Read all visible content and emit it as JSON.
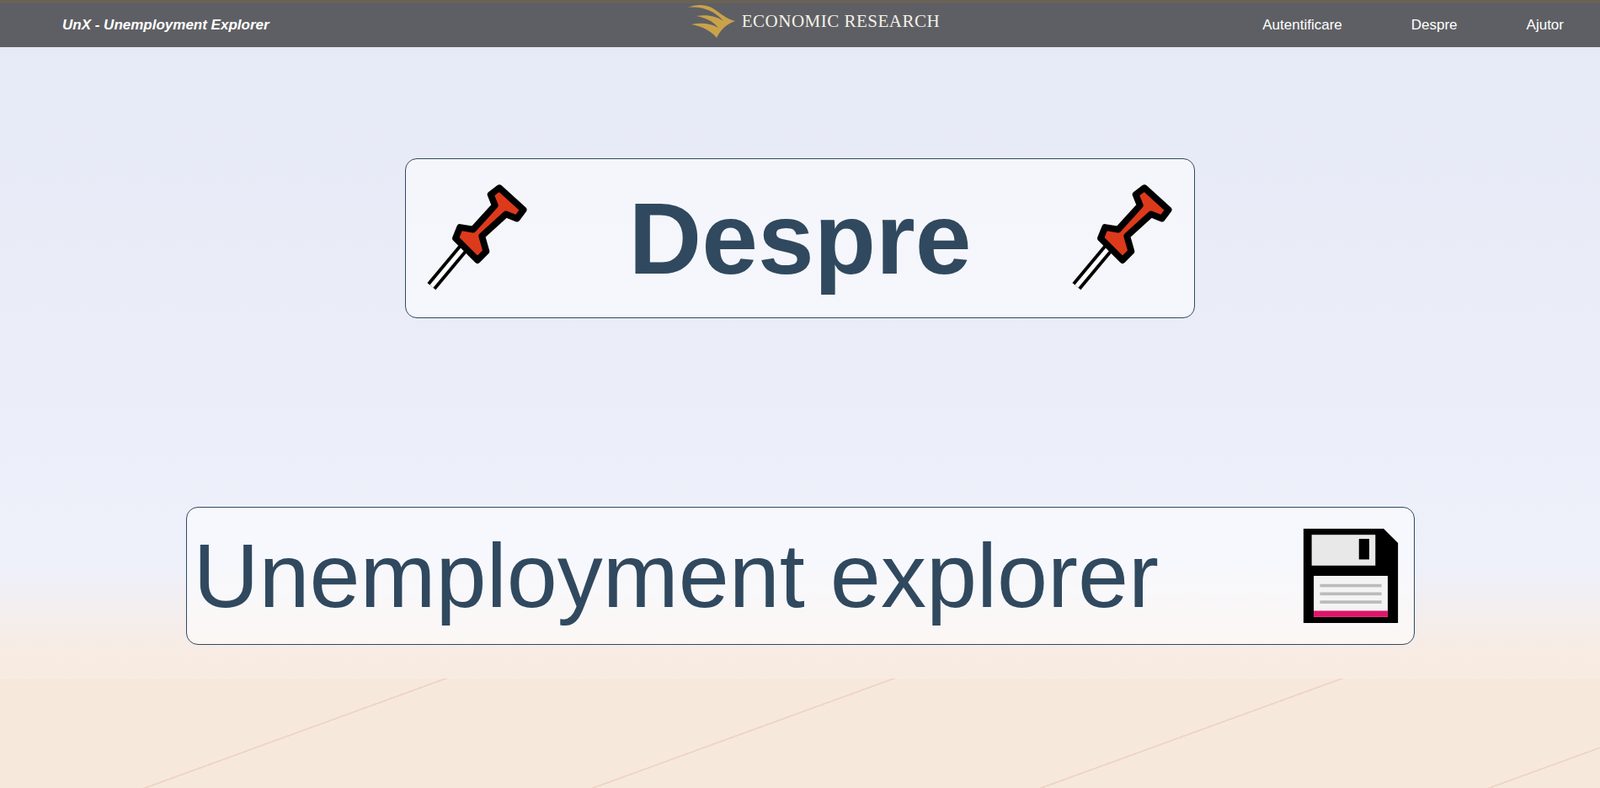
{
  "nav": {
    "brand": "UnX - Unemployment Explorer",
    "logo_text": "ECONOMIC RESEARCH",
    "links": [
      {
        "label": "Autentificare"
      },
      {
        "label": "Despre"
      },
      {
        "label": "Ajutor"
      }
    ]
  },
  "page": {
    "heading": "Despre",
    "title": "Unemployment explorer"
  }
}
